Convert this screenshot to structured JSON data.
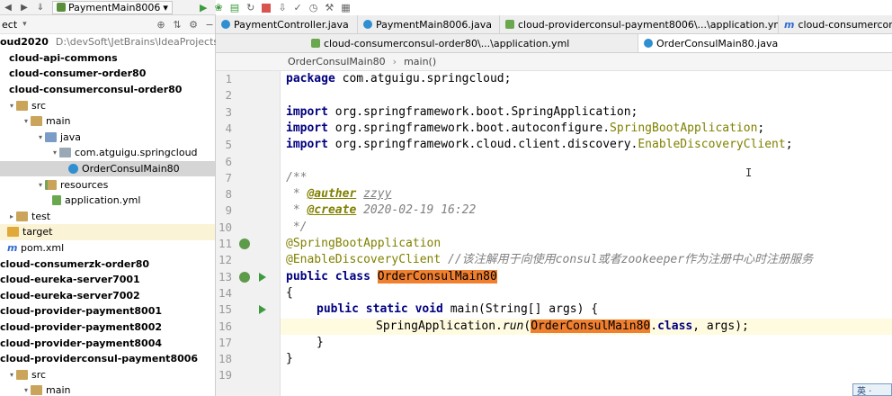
{
  "toolbar": {
    "run_config": "PaymentMain8006"
  },
  "project_panel": {
    "header": "ect",
    "rows": [
      {
        "label": "oud2020",
        "path": "D:\\devSoft\\JetBrains\\IdeaProjects\\clou",
        "bold": true
      },
      {
        "label": "cloud-api-commons",
        "bold": true
      },
      {
        "label": "cloud-consumer-order80",
        "bold": true
      },
      {
        "label": "cloud-consumerconsul-order80",
        "bold": true
      },
      {
        "label": "src"
      },
      {
        "label": "main"
      },
      {
        "label": "java"
      },
      {
        "label": "com.atguigu.springcloud"
      },
      {
        "label": "OrderConsulMain80"
      },
      {
        "label": "resources"
      },
      {
        "label": "application.yml"
      },
      {
        "label": "test"
      },
      {
        "label": "target"
      },
      {
        "label": "pom.xml"
      },
      {
        "label": "cloud-consumerzk-order80",
        "bold": true
      },
      {
        "label": "cloud-eureka-server7001",
        "bold": true
      },
      {
        "label": "cloud-eureka-server7002",
        "bold": true
      },
      {
        "label": "cloud-provider-payment8001",
        "bold": true
      },
      {
        "label": "cloud-provider-payment8002",
        "bold": true
      },
      {
        "label": "cloud-provider-payment8004",
        "bold": true
      },
      {
        "label": "cloud-providerconsul-payment8006",
        "bold": true
      },
      {
        "label": "src"
      },
      {
        "label": "main"
      }
    ]
  },
  "tabs_row1": [
    {
      "label": "PaymentController.java"
    },
    {
      "label": "PaymentMain8006.java"
    },
    {
      "label": "cloud-providerconsul-payment8006\\...\\application.yml"
    },
    {
      "label": "cloud-consumercons"
    }
  ],
  "tabs_row2": [
    {
      "label": "cloud-consumerconsul-order80\\...\\application.yml"
    },
    {
      "label": "OrderConsulMain80.java"
    }
  ],
  "breadcrumb": [
    "OrderConsulMain80",
    "main()"
  ],
  "code": {
    "line_numbers": [
      "1",
      "2",
      "3",
      "4",
      "5",
      "6",
      "7",
      "8",
      "9",
      "10",
      "11",
      "12",
      "13",
      "14",
      "15",
      "16",
      "17",
      "18",
      "19"
    ],
    "l1_kw": "package",
    "l1_rest": " com.atguigu.springcloud;",
    "l3_kw": "import",
    "l3_rest": " org.springframework.boot.SpringApplication;",
    "l4_kw": "import",
    "l4_a": " org.springframework.boot.autoconfigure.",
    "l4_b": "SpringBootApplication",
    "l4_c": ";",
    "l5_kw": "import",
    "l5_a": " org.springframework.cloud.client.discovery.",
    "l5_b": "EnableDiscoveryClient",
    "l5_c": ";",
    "l7": "/**",
    "l8_a": " * ",
    "l8_tag": "@auther",
    "l8_val": "zzyy",
    "l9_a": " * ",
    "l9_tag": "@create",
    "l9_val": "2020-02-19 16:22",
    "l10": " */",
    "l11": "@SpringBootApplication",
    "l12_ann": "@EnableDiscoveryClient",
    "l12_cm": " //该注解用于向使用consul或者zookeeper作为注册中心时注册服务",
    "l13_kw": "public class",
    "l13_name": "OrderConsulMain80",
    "l14": "{",
    "l15_kw": "public static void",
    "l15_rest": " main(String[] args) {",
    "l16_a": "SpringApplication.",
    "l16_run": "run",
    "l16_b": "(",
    "l16_name": "OrderConsulMain80",
    "l16_cls": "class",
    "l16_c": ", args);",
    "l17": "}",
    "l18": "}"
  },
  "ime": "英 ·"
}
